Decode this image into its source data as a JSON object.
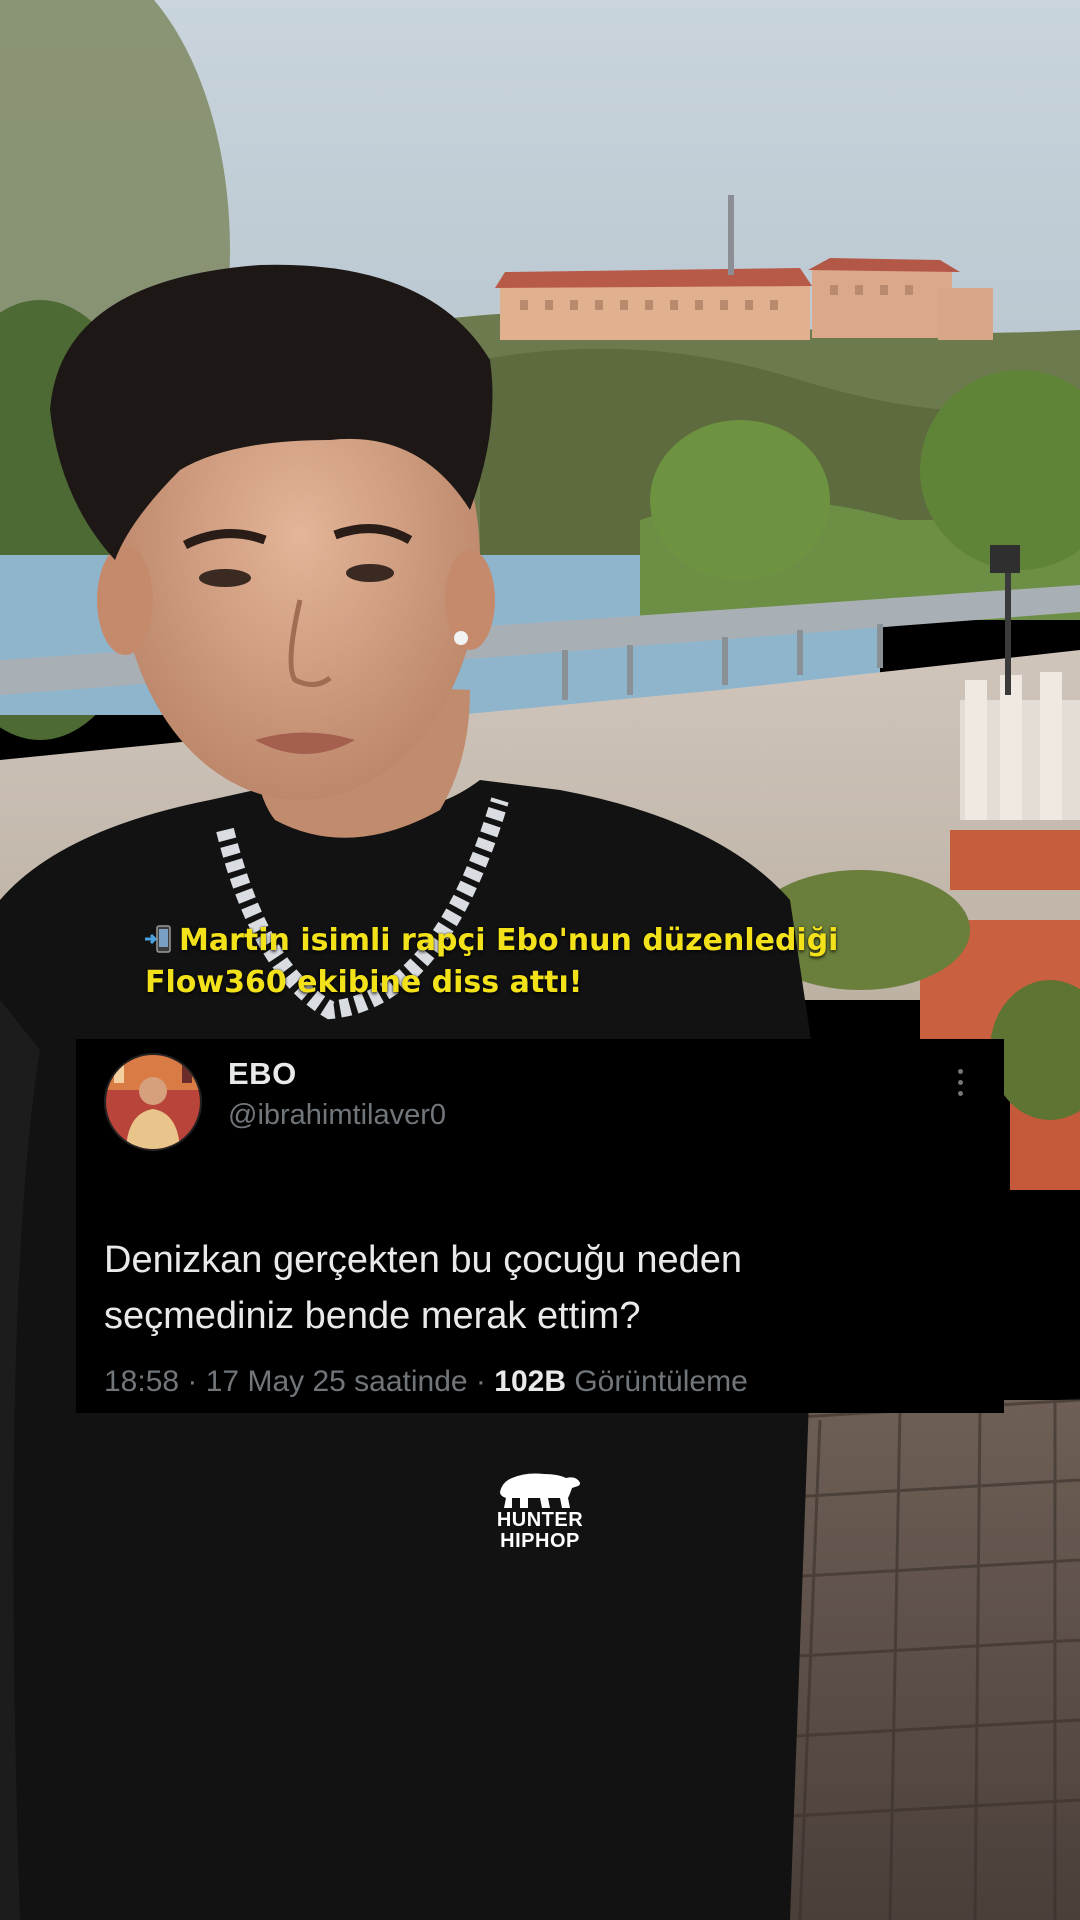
{
  "caption": {
    "icon": "mobile-arrow-icon",
    "line1": "Martin isimli rapçi Ebo'nun düzenlediği",
    "line2": "Flow360 ekibine diss attı!",
    "color": "#f3e21a"
  },
  "tweet": {
    "name": "EBO",
    "handle": "@ibrahimtilaver0",
    "text_line1": "Denizkan gerçekten bu çocuğu neden",
    "text_line2": "seçmediniz bende merak ettim?",
    "time": "18:58",
    "sep": " · ",
    "date": "17 May 25 saatinde",
    "views_count": "102B",
    "views_label": "Görüntüleme"
  },
  "logo": {
    "line1": "HUNTER",
    "line2": "HIPHOP",
    "icon": "bear-icon"
  }
}
